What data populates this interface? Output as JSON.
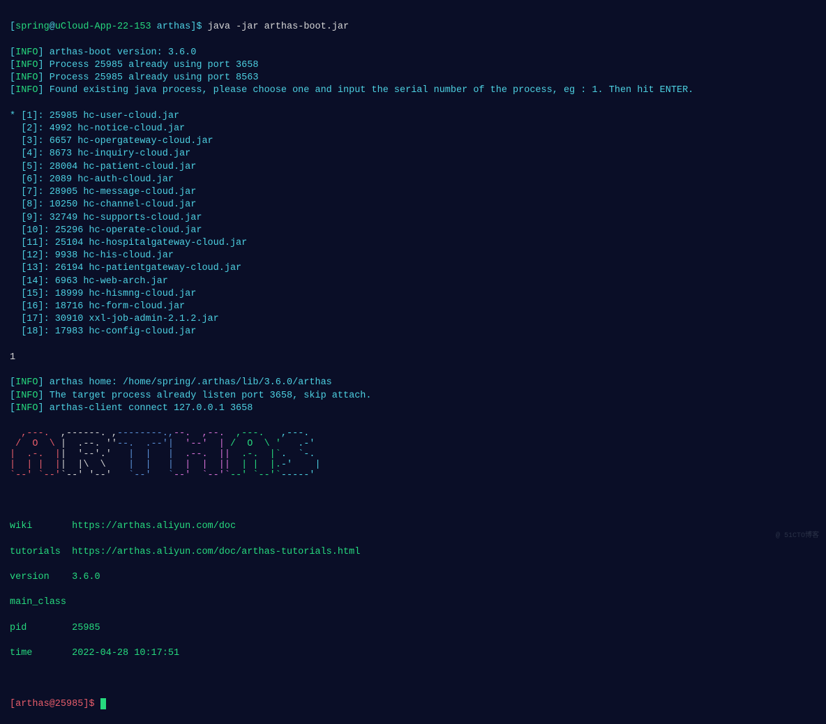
{
  "prompt1": {
    "user": "spring",
    "host": "uCloud-App-22-153",
    "path": "arthas",
    "command": "java -jar arthas-boot.jar"
  },
  "info_lines": [
    "arthas-boot version: 3.6.0",
    "Process 25985 already using port 3658",
    "Process 25985 already using port 8563",
    "Found existing java process, please choose one and input the serial number of the process, eg : 1. Then hit ENTER."
  ],
  "processes": [
    {
      "idx": "1",
      "pid": "25985",
      "name": "hc-user-cloud.jar",
      "selected": true
    },
    {
      "idx": "2",
      "pid": "4992",
      "name": "hc-notice-cloud.jar",
      "selected": false
    },
    {
      "idx": "3",
      "pid": "6657",
      "name": "hc-opergateway-cloud.jar",
      "selected": false
    },
    {
      "idx": "4",
      "pid": "8673",
      "name": "hc-inquiry-cloud.jar",
      "selected": false
    },
    {
      "idx": "5",
      "pid": "28004",
      "name": "hc-patient-cloud.jar",
      "selected": false
    },
    {
      "idx": "6",
      "pid": "2089",
      "name": "hc-auth-cloud.jar",
      "selected": false
    },
    {
      "idx": "7",
      "pid": "28905",
      "name": "hc-message-cloud.jar",
      "selected": false
    },
    {
      "idx": "8",
      "pid": "10250",
      "name": "hc-channel-cloud.jar",
      "selected": false
    },
    {
      "idx": "9",
      "pid": "32749",
      "name": "hc-supports-cloud.jar",
      "selected": false
    },
    {
      "idx": "10",
      "pid": "25296",
      "name": "hc-operate-cloud.jar",
      "selected": false
    },
    {
      "idx": "11",
      "pid": "25104",
      "name": "hc-hospitalgateway-cloud.jar",
      "selected": false
    },
    {
      "idx": "12",
      "pid": "9938",
      "name": "hc-his-cloud.jar",
      "selected": false
    },
    {
      "idx": "13",
      "pid": "26194",
      "name": "hc-patientgateway-cloud.jar",
      "selected": false
    },
    {
      "idx": "14",
      "pid": "6963",
      "name": "hc-web-arch.jar",
      "selected": false
    },
    {
      "idx": "15",
      "pid": "18999",
      "name": "hc-hismng-cloud.jar",
      "selected": false
    },
    {
      "idx": "16",
      "pid": "18716",
      "name": "hc-form-cloud.jar",
      "selected": false
    },
    {
      "idx": "17",
      "pid": "30910",
      "name": "xxl-job-admin-2.1.2.jar",
      "selected": false
    },
    {
      "idx": "18",
      "pid": "17983",
      "name": "hc-config-cloud.jar",
      "selected": false
    }
  ],
  "user_input": "1",
  "post_info": [
    "arthas home: /home/spring/.arthas/lib/3.6.0/arthas",
    "The target process already listen port 3658, skip attach.",
    "arthas-client connect 127.0.0.1 3658"
  ],
  "ascii_art": [
    "  ,---.  ,------. ,--------.,--.  ,--.  ,---.   ,---.  ",
    " /  O  \\ |  .--. ''--.  .--'|  '--'  | /  O  \\ '   .-' ",
    "|  .-.  ||  '--'.'   |  |   |  .--.  ||  .-.  |`.  `-. ",
    "|  | |  ||  |\\  \\    |  |   |  |  |  ||  | |  |.-'    |",
    "`--' `--'`--' '--'   `--'   `--'  `--'`--' `--'`-----' "
  ],
  "details": {
    "wiki_label": "wiki",
    "wiki_url": "https://arthas.aliyun.com/doc",
    "tutorials_label": "tutorials",
    "tutorials_url": "https://arthas.aliyun.com/doc/arthas-tutorials.html",
    "version_label": "version",
    "version_value": "3.6.0",
    "main_class_label": "main_class",
    "main_class_value": "",
    "pid_label": "pid",
    "pid_value": "25985",
    "time_label": "time",
    "time_value": "2022-04-28 10:17:51"
  },
  "prompt2": {
    "text": "[arthas@25985]$"
  },
  "watermark": "@ 51CTO博客"
}
